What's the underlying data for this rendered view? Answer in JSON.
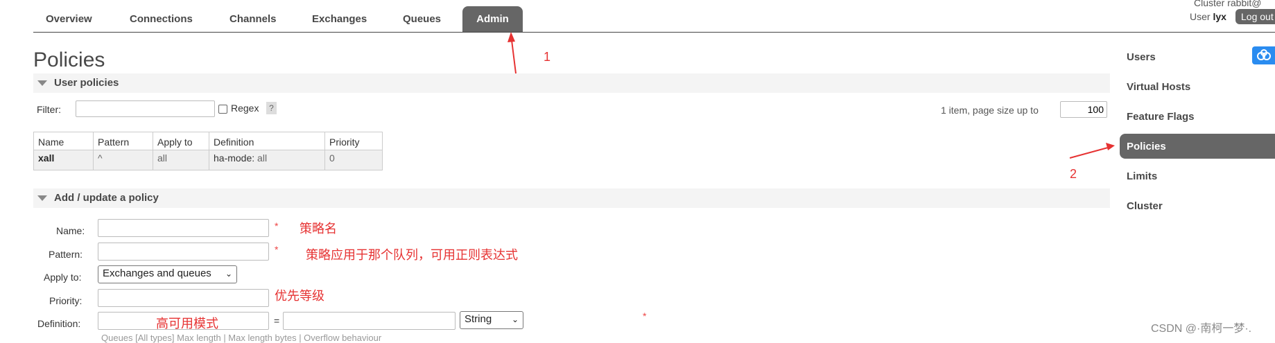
{
  "header": {
    "tabs": [
      {
        "label": "Overview"
      },
      {
        "label": "Connections"
      },
      {
        "label": "Channels"
      },
      {
        "label": "Exchanges"
      },
      {
        "label": "Queues"
      },
      {
        "label": "Admin",
        "active": true
      }
    ],
    "cluster_label": "Cluster rabbit@",
    "user_prefix": "User",
    "user_name": "lyx",
    "logout_label": "Log out"
  },
  "page": {
    "title": "Policies",
    "user_policies": {
      "section_label": "User policies",
      "filter_label": "Filter:",
      "filter_value": "",
      "regex_label": "Regex",
      "help_label": "?",
      "paging_text": "1 item, page size up to",
      "page_size": "100",
      "columns": [
        "Name",
        "Pattern",
        "Apply to",
        "Definition",
        "Priority"
      ],
      "rows": [
        {
          "name": "xall",
          "pattern": "^",
          "apply_to": "all",
          "definition_key": "ha-mode:",
          "definition_value": "all",
          "priority": "0"
        }
      ]
    },
    "add_policy": {
      "section_label": "Add / update a policy",
      "name_label": "Name:",
      "pattern_label": "Pattern:",
      "apply_to_label": "Apply to:",
      "apply_to_selected": "Exchanges and queues",
      "priority_label": "Priority:",
      "definition_label": "Definition:",
      "definition_eq": "=",
      "definition_type_selected": "String",
      "required_mark": "*",
      "hint_partial": "Queues [All types]    Max length  |  Max length bytes  |  Overflow behaviour"
    }
  },
  "annotations": {
    "name_note": "策略名",
    "pattern_note": "策略应用于那个队列，可用正则表达式",
    "priority_note": "优先等级",
    "definition_note": "高可用模式",
    "marker_1": "1",
    "marker_2": "2"
  },
  "sidebar": {
    "items": [
      {
        "label": "Users"
      },
      {
        "label": "Virtual Hosts"
      },
      {
        "label": "Feature Flags"
      },
      {
        "label": "Policies",
        "active": true
      },
      {
        "label": "Limits"
      },
      {
        "label": "Cluster"
      }
    ]
  },
  "watermark": "CSDN @·南柯一梦·.",
  "colors": {
    "accent": "#666666",
    "annotation": "#e63232",
    "cloud_button": "#2a8cf0"
  }
}
